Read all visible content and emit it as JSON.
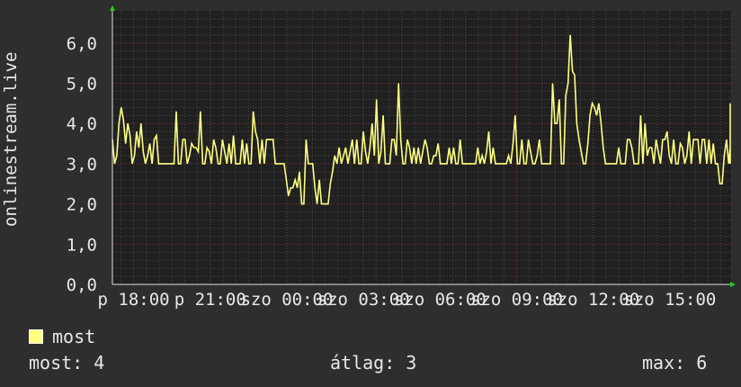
{
  "chart_data": {
    "type": "line",
    "ylabel": "onlinestream.live",
    "ylim": [
      0,
      6.8
    ],
    "y_ticks": [
      "0,0",
      "1,0",
      "2,0",
      "3,0",
      "4,0",
      "5,0",
      "6,0"
    ],
    "y_tick_values": [
      0,
      1,
      2,
      3,
      4,
      5,
      6
    ],
    "x_range": [
      -0.33,
      23.9
    ],
    "x_tick_labels": [
      "p 18:00",
      "p 21:00",
      "szo 00:00",
      "szo 03:00",
      "szo 06:00",
      "szo 09:00",
      "szo 12:00",
      "szo 15:00"
    ],
    "x_tick_positions": [
      0.5,
      3.5,
      6.5,
      9.5,
      12.5,
      15.5,
      18.5,
      21.5
    ],
    "grid": true,
    "series": [
      {
        "name": "most",
        "color": "#ffff80",
        "x_start": -0.33,
        "x_step": 0.0862,
        "values": [
          3.6,
          3.0,
          3.2,
          4.0,
          4.4,
          4.1,
          3.5,
          4.0,
          3.7,
          3.0,
          3.2,
          3.8,
          3.4,
          4.0,
          3.3,
          3.0,
          3.2,
          3.5,
          3.0,
          3.6,
          3.7,
          3.0,
          3.0,
          3.0,
          3.0,
          3.0,
          3.0,
          3.0,
          3.0,
          4.3,
          3.0,
          3.0,
          3.6,
          3.6,
          3.0,
          3.2,
          3.5,
          3.4,
          3.4,
          3.3,
          4.3,
          3.0,
          3.0,
          3.4,
          3.3,
          3.0,
          3.6,
          3.4,
          3.0,
          3.0,
          3.6,
          3.3,
          3.0,
          3.5,
          3.0,
          3.7,
          3.0,
          3.0,
          3.0,
          3.6,
          3.0,
          3.5,
          3.0,
          3.0,
          4.3,
          3.8,
          3.6,
          3.0,
          3.6,
          3.0,
          3.6,
          3.6,
          3.6,
          3.6,
          3.0,
          3.0,
          3.0,
          3.0,
          3.0,
          2.6,
          2.2,
          2.4,
          2.4,
          2.6,
          2.4,
          2.8,
          2.0,
          2.0,
          3.6,
          3.0,
          3.0,
          3.0,
          2.4,
          2.0,
          2.6,
          2.0,
          2.0,
          2.0,
          2.0,
          2.5,
          2.8,
          3.2,
          3.0,
          3.4,
          3.0,
          3.2,
          3.4,
          3.0,
          3.3,
          3.6,
          3.0,
          3.6,
          3.0,
          3.0,
          3.8,
          3.3,
          3.0,
          3.4,
          4.0,
          3.2,
          4.6,
          3.0,
          3.3,
          4.2,
          3.0,
          3.0,
          3.0,
          3.6,
          3.6,
          3.2,
          5.0,
          3.6,
          3.0,
          3.0,
          3.6,
          3.4,
          3.0,
          3.4,
          3.0,
          3.4,
          3.0,
          3.3,
          3.6,
          3.4,
          3.0,
          3.0,
          3.2,
          3.2,
          3.5,
          3.0,
          3.0,
          3.0,
          3.0,
          3.4,
          3.0,
          3.4,
          3.0,
          3.0,
          3.6,
          3.0,
          3.0,
          3.0,
          3.0,
          3.0,
          3.0,
          3.0,
          3.4,
          3.0,
          3.2,
          3.0,
          3.3,
          3.8,
          3.0,
          3.4,
          3.0,
          3.0,
          3.0,
          3.0,
          3.0,
          3.0,
          3.2,
          3.0,
          3.5,
          4.2,
          3.0,
          3.0,
          3.6,
          3.0,
          3.0,
          3.6,
          3.3,
          3.0,
          3.0,
          3.2,
          3.6,
          3.0,
          3.0,
          3.0,
          3.0,
          3.0,
          5.0,
          4.0,
          4.0,
          4.6,
          3.0,
          3.0,
          4.7,
          5.0,
          6.2,
          5.3,
          5.2,
          4.0,
          3.6,
          3.3,
          3.0,
          3.0,
          3.5,
          4.2,
          4.5,
          4.4,
          4.2,
          4.5,
          4.0,
          3.4,
          3.0,
          3.0,
          3.0,
          3.0,
          3.0,
          3.0,
          3.4,
          3.0,
          3.0,
          3.0,
          3.6,
          3.6,
          3.4,
          3.0,
          3.0,
          3.0,
          4.2,
          3.0,
          4.0,
          3.2,
          3.4,
          3.4,
          3.0,
          3.6,
          3.3,
          3.0,
          3.6,
          3.6,
          3.8,
          3.2,
          3.0,
          3.6,
          3.0,
          3.0,
          3.5,
          3.4,
          3.0,
          3.2,
          3.8,
          3.0,
          3.6,
          3.6,
          3.6,
          3.0,
          3.6,
          3.6,
          3.0,
          3.6,
          3.0,
          3.5,
          3.0,
          3.0,
          2.5,
          2.5,
          3.2,
          3.6,
          3.0,
          3.4,
          3.0,
          3.6,
          3.0,
          4.0,
          3.6,
          3.4,
          3.0,
          3.0,
          3.0,
          3.4,
          3.0,
          3.0,
          3.0,
          3.0,
          3.0,
          3.0,
          3.5,
          3.2,
          3.6,
          3.0,
          3.0,
          3.0,
          4.0,
          3.0,
          4.0,
          3.3,
          4.4,
          3.5,
          3.0,
          4.5,
          3.6,
          4.0,
          3.4,
          3.6,
          3.0,
          3.6,
          3.2,
          3.6,
          3.0,
          4.5,
          3.6,
          3.0,
          3.0,
          3.6,
          3.0,
          3.6,
          3.6
        ]
      }
    ]
  },
  "legend": {
    "label": "most",
    "color": "#ffff80"
  },
  "stats": {
    "now": "most: 4",
    "avg": "átlag: 3",
    "max": "max: 6"
  }
}
